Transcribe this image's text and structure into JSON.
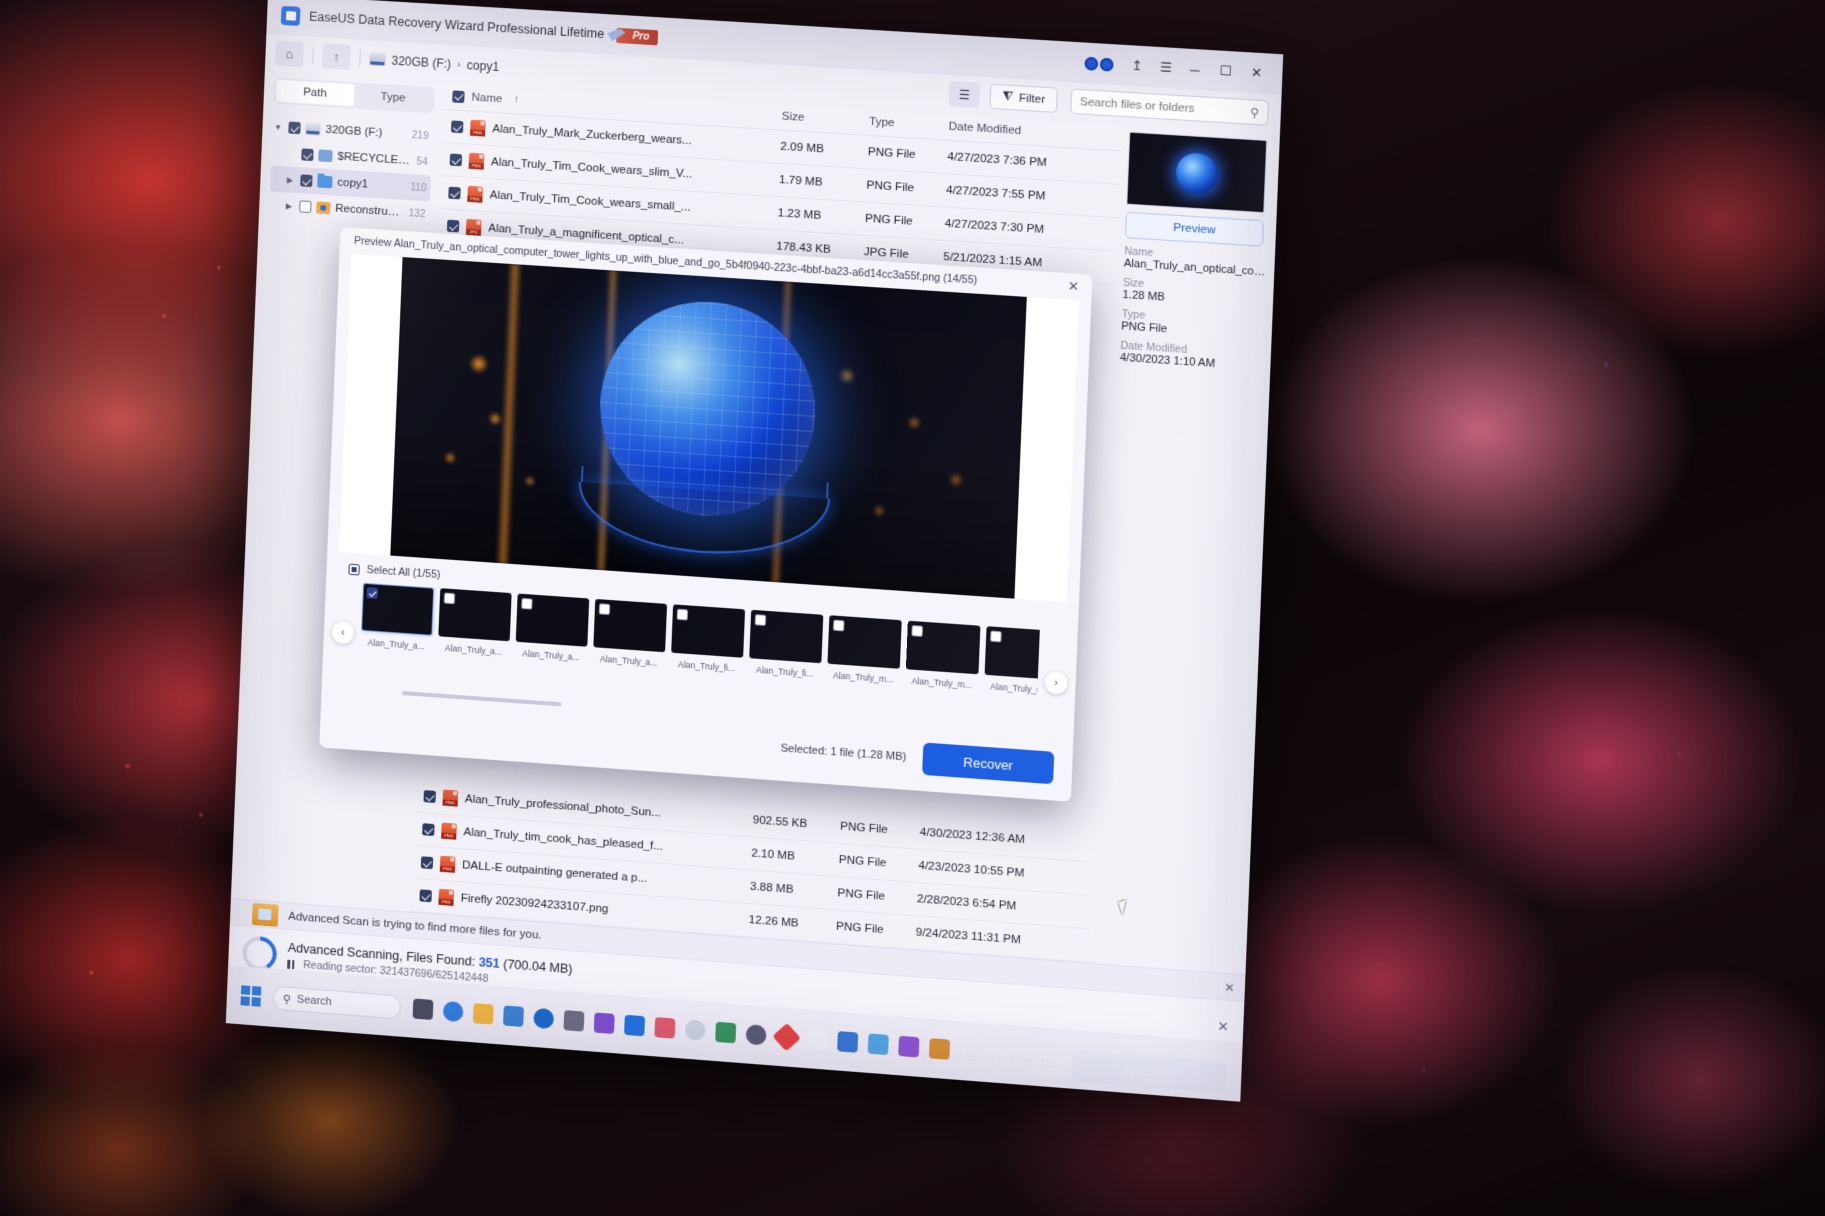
{
  "window": {
    "title": "EaseUS Data Recovery Wizard Professional Lifetime",
    "pro_badge": "Pro",
    "minimize": "─",
    "maximize": "☐",
    "close": "✕",
    "menu_icon": "☰",
    "export_icon": "↥",
    "eyes_icon": "eyes-icon"
  },
  "toolbar": {
    "home_icon": "⌂",
    "up_icon": "↑",
    "breadcrumb": [
      "320GB (F:)",
      "copy1"
    ],
    "chevron": "›",
    "view_icon": "☰",
    "filter_label": "Filter",
    "filter_icon": "⧨",
    "search_placeholder": "Search files or folders",
    "search_value": "",
    "search_icon": "⚲"
  },
  "sidebar": {
    "tabs": [
      {
        "label": "Path",
        "active": true
      },
      {
        "label": "Type",
        "active": false
      }
    ],
    "tree": [
      {
        "label": "320GB (F:)",
        "count": "219",
        "icon": "drive-icon",
        "checked": true,
        "expanded": true,
        "indent": 0,
        "selected": false
      },
      {
        "label": "$RECYCLE.BIN",
        "count": "54",
        "icon": "recycle-bin-icon",
        "checked": true,
        "expanded": false,
        "indent": 1,
        "selected": false
      },
      {
        "label": "copy1",
        "count": "110",
        "icon": "folder-icon",
        "checked": true,
        "expanded": false,
        "indent": 1,
        "selected": true
      },
      {
        "label": "Reconstructed",
        "count": "132",
        "icon": "reconstructed-folder-icon",
        "checked": false,
        "expanded": false,
        "indent": 1,
        "selected": false
      }
    ]
  },
  "filelist": {
    "columns": [
      "Name",
      "Size",
      "Type",
      "Date Modified"
    ],
    "sort_indicator": "↑",
    "header_checked": true,
    "rows": [
      {
        "name": "Alan_Truly_Mark_Zuckerberg_wears...",
        "size": "2.09 MB",
        "type": "PNG File",
        "date": "4/27/2023 7:36 PM",
        "icon": "png-file-icon",
        "checked": true
      },
      {
        "name": "Alan_Truly_Tim_Cook_wears_slim_V...",
        "size": "1.79 MB",
        "type": "PNG File",
        "date": "4/27/2023 7:55 PM",
        "icon": "png-file-icon",
        "checked": true
      },
      {
        "name": "Alan_Truly_Tim_Cook_wears_small_...",
        "size": "1.23 MB",
        "type": "PNG File",
        "date": "4/27/2023 7:30 PM",
        "icon": "png-file-icon",
        "checked": true
      },
      {
        "name": "Alan_Truly_a_magnificent_optical_c...",
        "size": "178.43 KB",
        "type": "JPG File",
        "date": "5/21/2023 1:15 AM",
        "icon": "jpg-file-icon",
        "checked": true
      }
    ],
    "rows_below": [
      {
        "name": "Alan_Truly_professional_photo_Sun...",
        "size": "902.55 KB",
        "type": "PNG File",
        "date": "4/30/2023 12:36 AM",
        "icon": "png-file-icon",
        "checked": true
      },
      {
        "name": "Alan_Truly_tim_cook_has_pleased_f...",
        "size": "2.10 MB",
        "type": "PNG File",
        "date": "4/23/2023 10:55 PM",
        "icon": "png-file-icon",
        "checked": true
      },
      {
        "name": "DALL-E outpainting generated a p...",
        "size": "3.88 MB",
        "type": "PNG File",
        "date": "2/28/2023 6:54 PM",
        "icon": "png-file-icon",
        "checked": true
      },
      {
        "name": "Firefly 20230924233107.png",
        "size": "12.26 MB",
        "type": "PNG File",
        "date": "9/24/2023 11:31 PM",
        "icon": "png-file-icon",
        "checked": true
      }
    ]
  },
  "preview_panel": {
    "button_label": "Preview",
    "fields": [
      {
        "key": "Name",
        "value": "Alan_Truly_an_optical_com..."
      },
      {
        "key": "Size",
        "value": "1.28 MB"
      },
      {
        "key": "Type",
        "value": "PNG File"
      },
      {
        "key": "Date Modified",
        "value": "4/30/2023 1:10 AM"
      }
    ]
  },
  "modal": {
    "title": "Preview Alan_Truly_an_optical_computer_tower_lights_up_with_blue_and_go_5b4f0940-223c-4bbf-ba23-a6d14cc3a55f.png (14/55)",
    "close_icon": "✕",
    "select_all_label": "Select All (1/55)",
    "prev_arrow": "‹",
    "next_arrow": "›",
    "selected_text": "Selected: 1 file (1.28 MB)",
    "recover_label": "Recover",
    "thumbnails": [
      {
        "caption": "Alan_Truly_a...",
        "active": true,
        "style": "t1"
      },
      {
        "caption": "Alan_Truly_a...",
        "active": false,
        "style": "t2"
      },
      {
        "caption": "Alan_Truly_a...",
        "active": false,
        "style": "t3"
      },
      {
        "caption": "Alan_Truly_a...",
        "active": false,
        "style": "t4"
      },
      {
        "caption": "Alan_Truly_fi...",
        "active": false,
        "style": "t5"
      },
      {
        "caption": "Alan_Truly_fi...",
        "active": false,
        "style": "t6"
      },
      {
        "caption": "Alan_Truly_m...",
        "active": false,
        "style": "t7"
      },
      {
        "caption": "Alan_Truly_m...",
        "active": false,
        "style": "t8"
      },
      {
        "caption": "Alan_Truly_m...",
        "active": false,
        "style": "t9"
      }
    ]
  },
  "hint_bar": {
    "text": "Advanced Scan is trying to find more files for you.",
    "close_icon": "✕"
  },
  "scan_bar": {
    "percent": "41%",
    "status_prefix": "Advanced Scanning, Files Found: ",
    "files_found": "351",
    "found_size": " (700.04 MB)",
    "pause_icon": "pause-icon",
    "sector_label": "Reading sector: 321437696/625142448",
    "close_icon": "✕"
  },
  "bottom_bar": {
    "selected_text": "Selected: 219 files ",
    "selected_size": "(491.69 MB)",
    "recover_label": "Recover"
  },
  "taskbar": {
    "start_icon": "windows-icon",
    "search_placeholder": "Search",
    "search_icon": "⚲"
  },
  "colors": {
    "accent": "#1559e0",
    "link": "#1f58cf",
    "app_bg": "#f2f1f7",
    "titlebar": "#e8e7f1"
  }
}
